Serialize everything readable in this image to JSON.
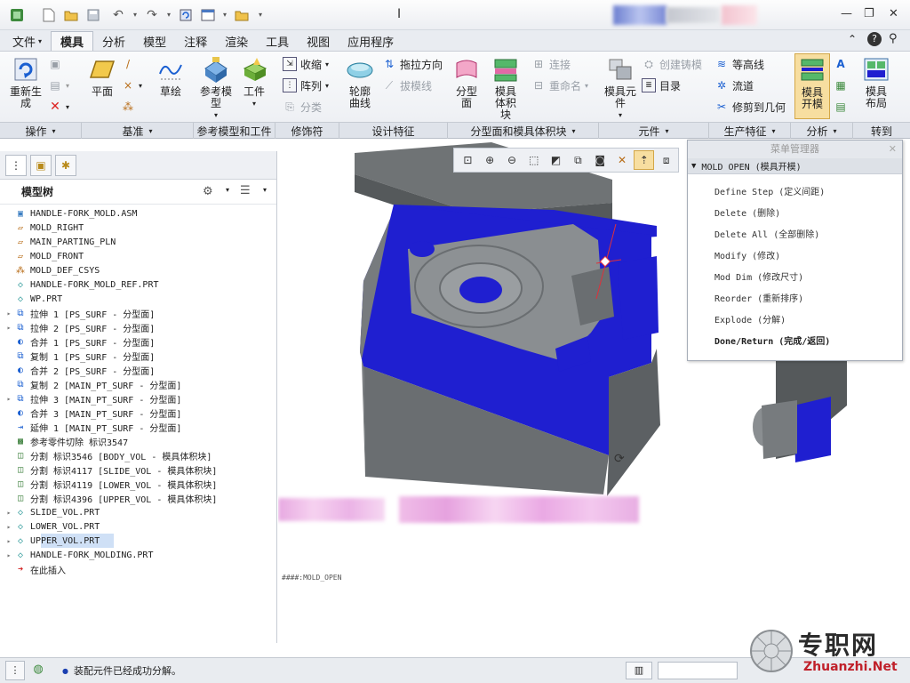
{
  "titlebar": {
    "cursor_glyph": "I"
  },
  "menu": {
    "file": "文件",
    "tabs": [
      "模具",
      "分析",
      "模型",
      "注释",
      "渲染",
      "工具",
      "视图",
      "应用程序"
    ]
  },
  "ribbon": {
    "regenerate": "重新生成",
    "plane": "平面",
    "sketch": "草绘",
    "ref_model": "参考模型",
    "workpiece": "工件",
    "shrink": "收缩",
    "pattern": "阵列",
    "classify": "分类",
    "silhouette": "轮廓曲线",
    "drag_direction": "拖拉方向",
    "draft_line": "拔模线",
    "parting_surface": "分型面",
    "mold_volume": "模具体积块",
    "connect": "连接",
    "rename": "重命名",
    "mold_component": "模具元件",
    "create_casting": "创建铸模",
    "catalog": "目录",
    "contour": "等高线",
    "flow": "流道",
    "trim_to_geom": "修剪到几何",
    "mold_open": "模具开模",
    "mold_layout": "模具布局",
    "groups": [
      "操作",
      "基准",
      "参考模型和工件",
      "修饰符",
      "设计特征",
      "分型面和模具体积块",
      "元件",
      "生产特征",
      "分析",
      "转到"
    ]
  },
  "tree": {
    "header": "模型树",
    "rows": [
      {
        "text": "HANDLE-FORK_MOLD.ASM",
        "icon": "assembly-icon",
        "exp": "",
        "indent": 0
      },
      {
        "text": "MOLD_RIGHT",
        "icon": "plane-icon",
        "exp": "",
        "indent": 1
      },
      {
        "text": "MAIN_PARTING_PLN",
        "icon": "plane-icon",
        "exp": "",
        "indent": 1
      },
      {
        "text": "MOLD_FRONT",
        "icon": "plane-icon",
        "exp": "",
        "indent": 1
      },
      {
        "text": "MOLD_DEF_CSYS",
        "icon": "csys-icon",
        "exp": "",
        "indent": 1
      },
      {
        "text": "HANDLE-FORK_MOLD_REF.PRT",
        "icon": "part-icon",
        "exp": "",
        "indent": 1
      },
      {
        "text": "WP.PRT",
        "icon": "part-icon",
        "exp": "",
        "indent": 1
      },
      {
        "text": "拉伸 1 [PS_SURF - 分型面]",
        "icon": "extrude-icon",
        "exp": "▸",
        "indent": 1
      },
      {
        "text": "拉伸 2 [PS_SURF - 分型面]",
        "icon": "extrude-icon",
        "exp": "▸",
        "indent": 1
      },
      {
        "text": "合并 1 [PS_SURF - 分型面]",
        "icon": "merge-icon",
        "exp": "",
        "indent": 1
      },
      {
        "text": "复制 1 [PS_SURF - 分型面]",
        "icon": "copy-icon",
        "exp": "",
        "indent": 1
      },
      {
        "text": "合并 2 [PS_SURF - 分型面]",
        "icon": "merge-icon",
        "exp": "",
        "indent": 1
      },
      {
        "text": "复制 2 [MAIN_PT_SURF - 分型面]",
        "icon": "copy-icon",
        "exp": "",
        "indent": 1
      },
      {
        "text": "拉伸 3 [MAIN_PT_SURF - 分型面]",
        "icon": "extrude-icon",
        "exp": "▸",
        "indent": 1
      },
      {
        "text": "合并 3 [MAIN_PT_SURF - 分型面]",
        "icon": "merge-icon",
        "exp": "",
        "indent": 1
      },
      {
        "text": "延伸 1 [MAIN_PT_SURF - 分型面]",
        "icon": "extend-icon",
        "exp": "",
        "indent": 1
      },
      {
        "text": "参考零件切除 标识3547",
        "icon": "cut-icon",
        "exp": "",
        "indent": 1
      },
      {
        "text": "分割 标识3546 [BODY_VOL - 模具体积块]",
        "icon": "split-icon",
        "exp": "",
        "indent": 1
      },
      {
        "text": "分割 标识4117 [SLIDE_VOL - 模具体积块]",
        "icon": "split-icon",
        "exp": "",
        "indent": 1
      },
      {
        "text": "分割 标识4119 [LOWER_VOL - 模具体积块]",
        "icon": "split-icon",
        "exp": "",
        "indent": 1
      },
      {
        "text": "分割 标识4396 [UPPER_VOL - 模具体积块]",
        "icon": "split-icon",
        "exp": "",
        "indent": 1
      },
      {
        "text": "SLIDE_VOL.PRT",
        "icon": "part-icon",
        "exp": "▸",
        "indent": 1
      },
      {
        "text": "LOWER_VOL.PRT",
        "icon": "part-icon",
        "exp": "▸",
        "indent": 1
      },
      {
        "text": "UPPER_VOL.PRT",
        "icon": "part-icon",
        "exp": "▸",
        "indent": 1
      },
      {
        "text": "HANDLE-FORK_MOLDING.PRT",
        "icon": "part-icon",
        "exp": "▸",
        "indent": 1
      },
      {
        "text": "在此插入",
        "icon": "insert-arrow-icon",
        "exp": "",
        "indent": 1
      }
    ]
  },
  "menu_manager": {
    "title": "菜单管理器",
    "section": "MOLD OPEN (模具开模)",
    "items": [
      "Define Step (定义间距)",
      "Delete (删除)",
      "Delete All (全部删除)",
      "Modify (修改)",
      "Mod Dim (修改尺寸)",
      "Reorder (重新排序)",
      "Explode (分解)",
      "Done/Return (完成/返回)"
    ]
  },
  "viewport": {
    "label": "####:MOLD_OPEN"
  },
  "status": {
    "message": "装配元件已经成功分解。"
  },
  "watermark": {
    "cn": "专职网",
    "url": "Zhuanzhi.Net"
  },
  "colors": {
    "accent": "#1f1fd0",
    "mold_gray": "#808487",
    "dark_gray": "#5b5f62"
  }
}
